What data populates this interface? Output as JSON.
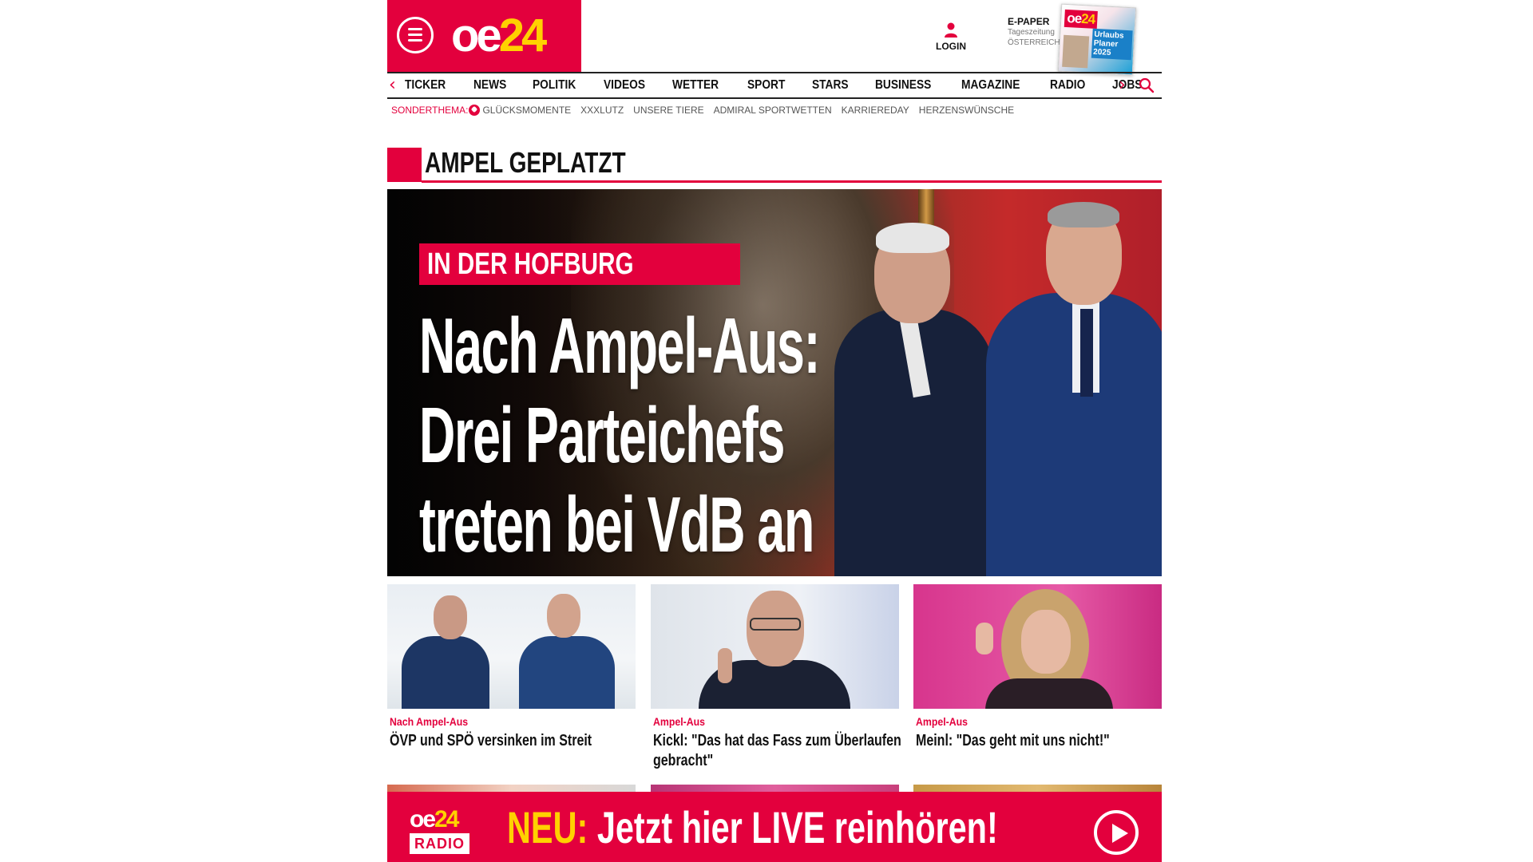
{
  "brand": {
    "logo_main": "oe",
    "logo_accent": "24",
    "accent_color": "#e3003d",
    "accent_yellow": "#ffd100"
  },
  "header": {
    "login_label": "LOGIN",
    "epaper": {
      "title": "E-PAPER",
      "subtitle1": "Tageszeitung",
      "subtitle2": "ÖSTERREICH",
      "cover_headline": "Urlaubs Planer 2025"
    }
  },
  "nav": {
    "items": [
      "TICKER",
      "NEWS",
      "POLITIK",
      "VIDEOS",
      "WETTER",
      "SPORT",
      "STARS",
      "BUSINESS",
      "MAGAZINE",
      "RADIO",
      "JOBS"
    ],
    "prev_arrow": "‹",
    "next_arrow": "›"
  },
  "subnav": {
    "label": "SONDERTHEMA:",
    "items": [
      "GLÜCKSMOMENTE",
      "XXXLUTZ",
      "UNSERE TIERE",
      "ADMIRAL SPORTWETTEN",
      "KARRIEREDAY",
      "HERZENSWÜNSCHE"
    ]
  },
  "section": {
    "title": "AMPEL GEPLATZT"
  },
  "hero": {
    "kicker": "IN DER HOFBURG",
    "headline_lines": [
      "Nach Ampel-Aus:",
      "Drei Parteichefs",
      "treten bei VdB an"
    ]
  },
  "cards": [
    {
      "kicker": "Nach Ampel-Aus",
      "title": "ÖVP und SPÖ versinken im Streit"
    },
    {
      "kicker": "Ampel-Aus",
      "title": "Kickl: \"Das hat das Fass zum Überlaufen gebracht\""
    },
    {
      "kicker": "Ampel-Aus",
      "title": "Meinl: \"Das geht mit uns nicht!\""
    }
  ],
  "radio_banner": {
    "logo_top": "oe",
    "logo_top_accent": "24",
    "logo_bottom": "RADIO",
    "neu": "NEU:",
    "text": "Jetzt hier LIVE reinhören!"
  },
  "icons": [
    "menu-icon",
    "user-icon",
    "search-icon",
    "heart-icon",
    "play-icon",
    "chevron-left-icon",
    "chevron-right-icon"
  ]
}
